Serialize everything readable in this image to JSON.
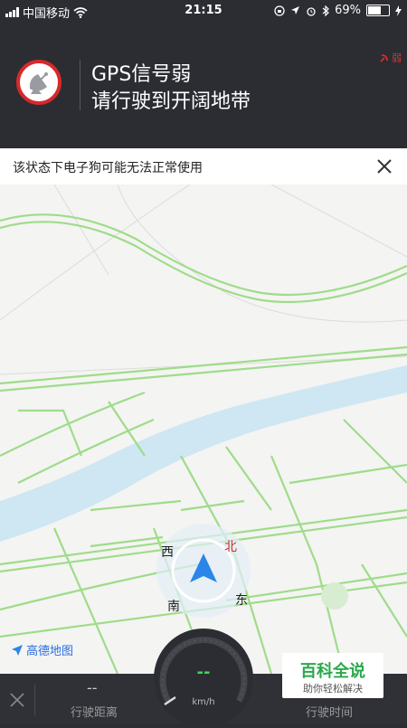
{
  "status_bar": {
    "carrier": "中国移动",
    "time": "21:15",
    "battery": "69%",
    "battery_level": 0.69
  },
  "gps_warning": {
    "mini_label": "弱",
    "title": "GPS信号弱",
    "subtitle": "请行驶到开阔地带"
  },
  "notice": {
    "text": "该状态下电子狗可能无法正常使用"
  },
  "map": {
    "compass": {
      "north": "北",
      "south": "南",
      "east": "东",
      "west": "西"
    },
    "logo": "高德地图"
  },
  "bottom_bar": {
    "distance_value": "--",
    "distance_label": "行驶距离",
    "speed_value": "--",
    "speed_unit": "km/h",
    "time_label": "行驶时间"
  },
  "watermark": {
    "main": "百科全说",
    "sub": "助你轻松解决"
  },
  "colors": {
    "header_bg": "#2b2d33",
    "warning_red": "#d7292a",
    "road_green": "#9edc8a",
    "river_blue": "#cfe6f3",
    "nav_arrow_blue": "#2a86e8",
    "speed_green": "#3dd65a"
  }
}
